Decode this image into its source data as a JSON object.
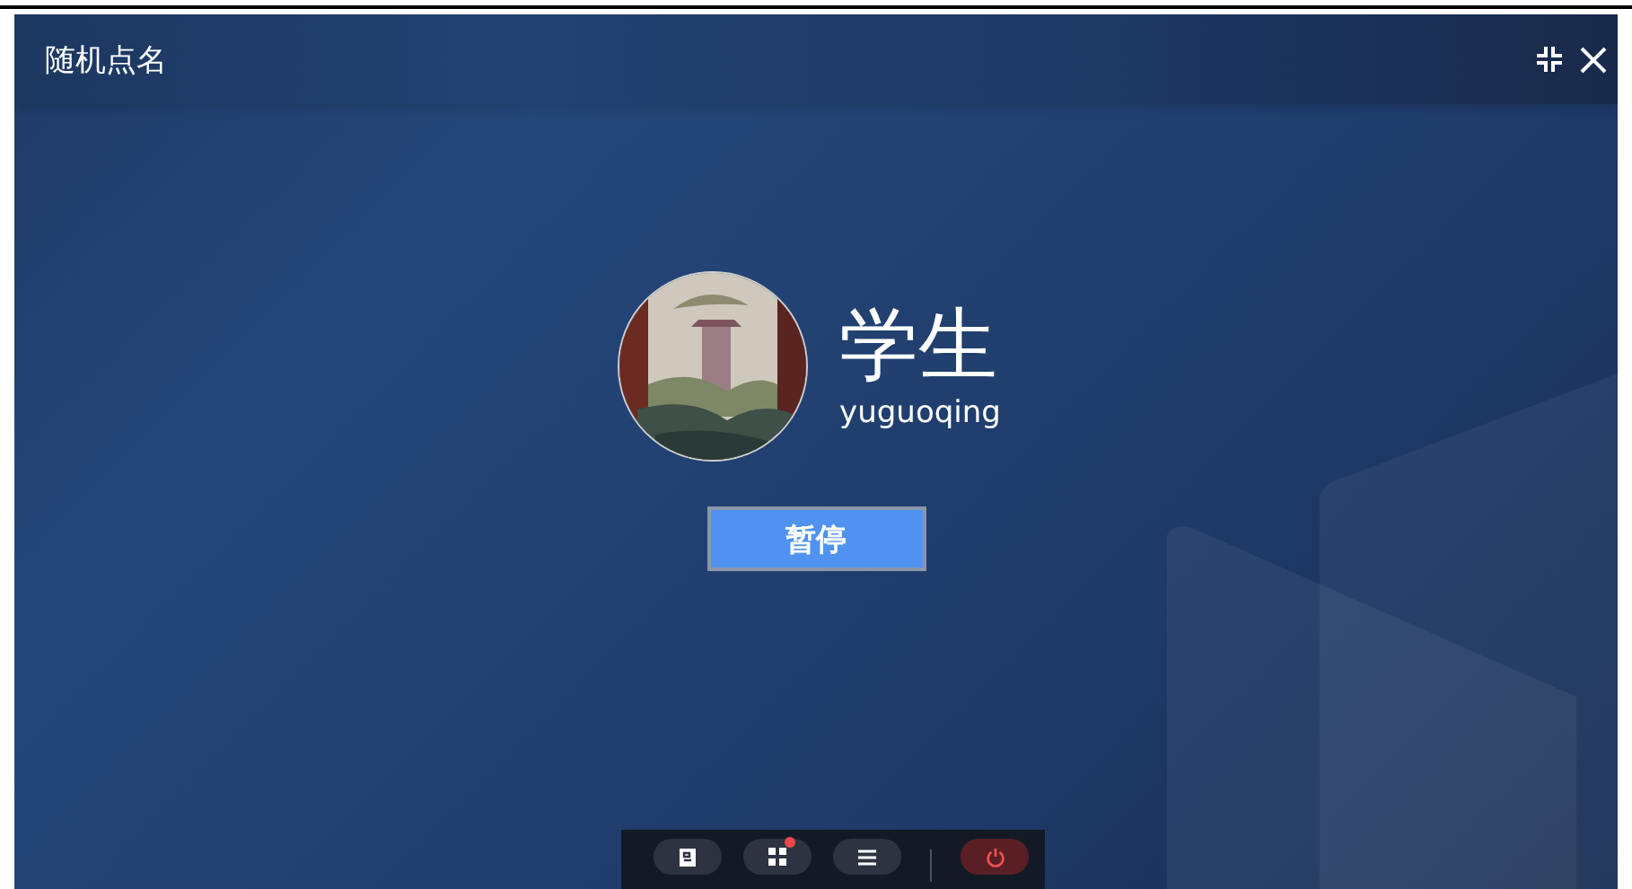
{
  "window": {
    "title": "随机点名"
  },
  "student": {
    "name": "学生",
    "username": "yuguoqing"
  },
  "action_button": {
    "label": "暂停"
  },
  "toolbar": [
    {
      "kind": "document",
      "badge": false
    },
    {
      "kind": "grid",
      "badge": true
    },
    {
      "kind": "menu",
      "badge": false
    },
    {
      "kind": "power",
      "badge": false
    }
  ]
}
